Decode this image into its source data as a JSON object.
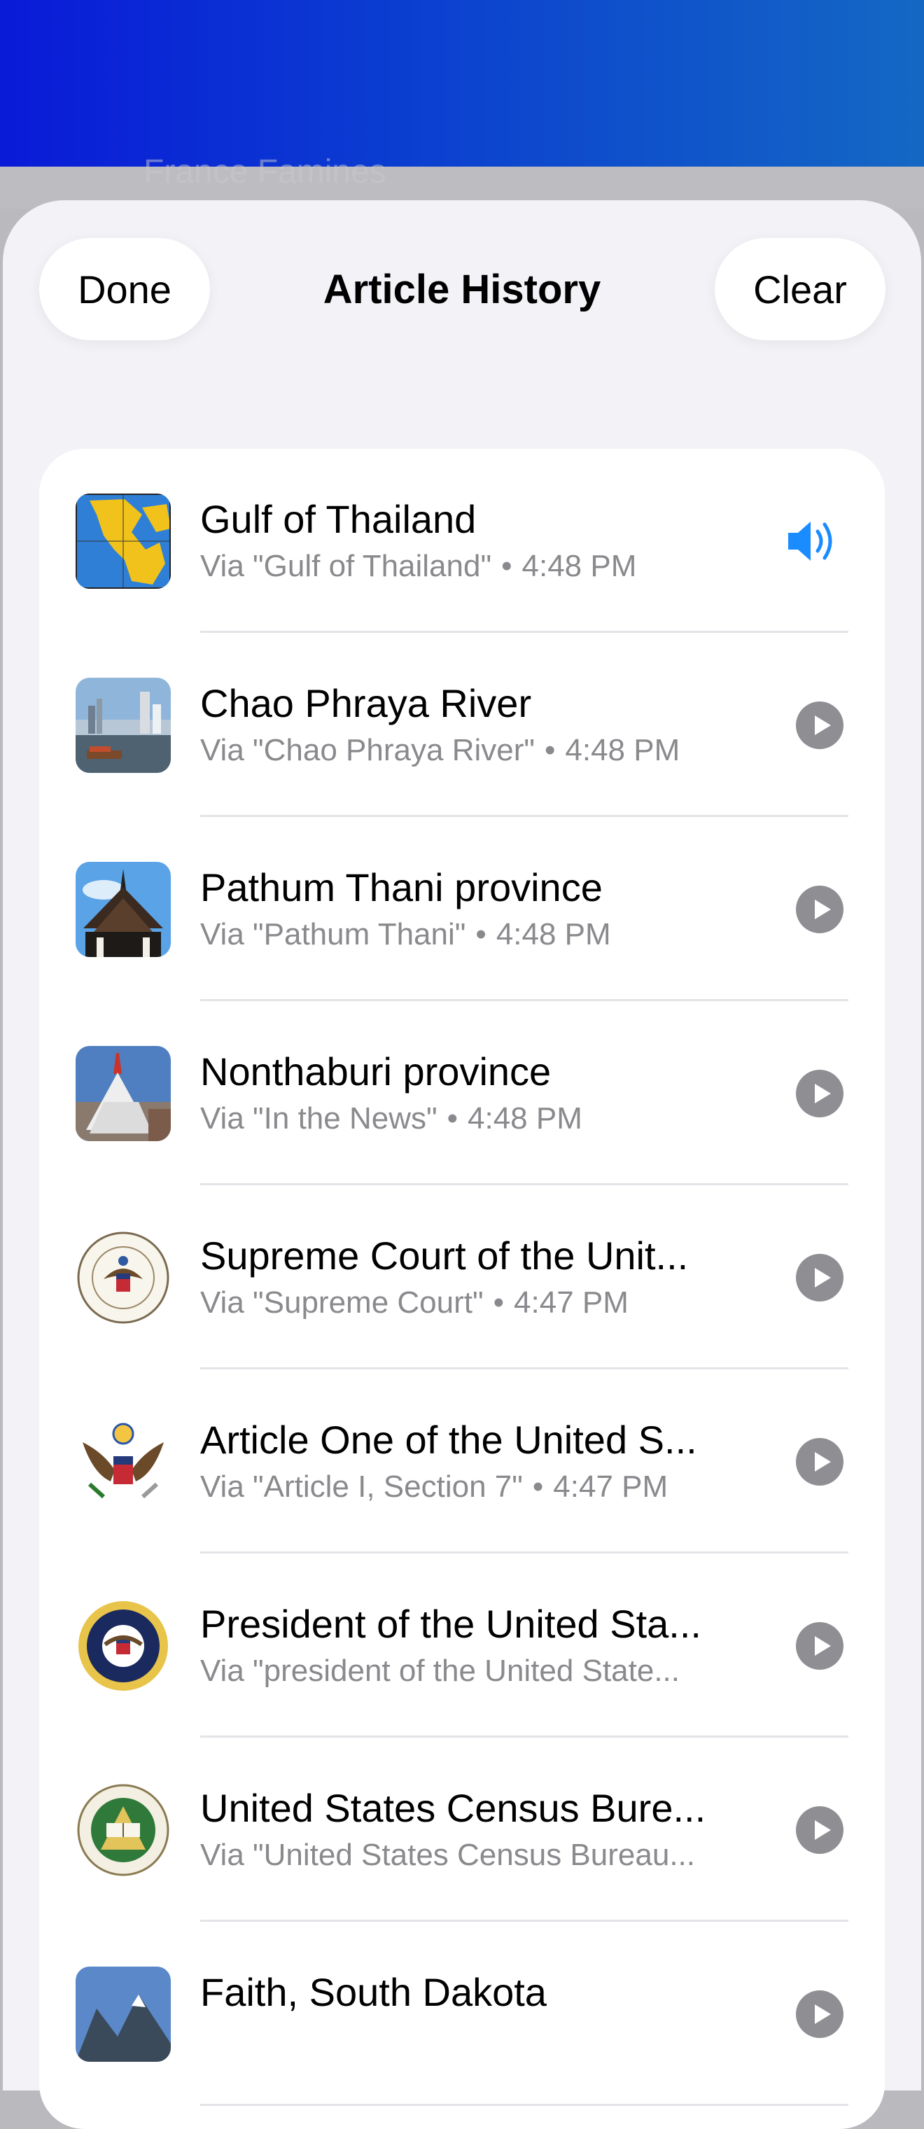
{
  "sheet": {
    "title": "Article History",
    "done_label": "Done",
    "clear_label": "Clear",
    "behind_text": "France Famines"
  },
  "colors": {
    "accent": "#1a8cff",
    "play_bg": "#8e8e93",
    "subtitle": "#8a8a8e"
  },
  "items": [
    {
      "title": "Gulf of Thailand",
      "via": "Via \"Gulf of Thailand\"",
      "time": "4:48 PM",
      "state": "playing",
      "icon": "speaker-icon",
      "thumb": "map"
    },
    {
      "title": "Chao Phraya River",
      "via": "Via \"Chao Phraya River\"",
      "time": "4:48 PM",
      "state": "idle",
      "icon": "play-icon",
      "thumb": "river"
    },
    {
      "title": "Pathum Thani province",
      "via": "Via \"Pathum Thani\"",
      "time": "4:48 PM",
      "state": "idle",
      "icon": "play-icon",
      "thumb": "temple"
    },
    {
      "title": "Nonthaburi province",
      "via": "Via \"In the News\"",
      "time": "4:48 PM",
      "state": "idle",
      "icon": "play-icon",
      "thumb": "stupa"
    },
    {
      "title": "Supreme Court of the Unit...",
      "via": "Via \"Supreme Court\"",
      "time": "4:47 PM",
      "state": "idle",
      "icon": "play-icon",
      "thumb": "seal-court"
    },
    {
      "title": "Article One of the United S...",
      "via": "Via \"Article I, Section 7\"",
      "time": "4:47 PM",
      "state": "idle",
      "icon": "play-icon",
      "thumb": "eagle"
    },
    {
      "title": "President of the United Sta...",
      "via": "Via \"president of the United State...",
      "time": "",
      "state": "idle",
      "icon": "play-icon",
      "thumb": "seal-president"
    },
    {
      "title": "United States Census Bure...",
      "via": "Via \"United States Census Bureau...",
      "time": "",
      "state": "idle",
      "icon": "play-icon",
      "thumb": "seal-census"
    },
    {
      "title": "Faith, South Dakota",
      "via": "",
      "time": "",
      "state": "idle",
      "icon": "play-icon",
      "thumb": "mountain"
    }
  ]
}
